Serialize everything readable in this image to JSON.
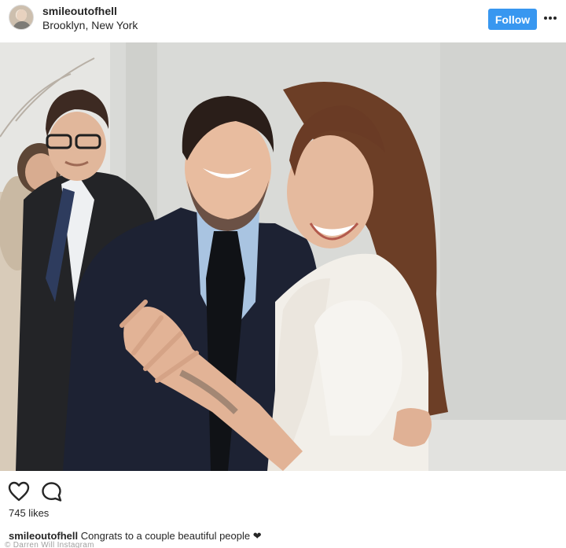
{
  "header": {
    "username": "smileoutofhell",
    "location": "Brooklyn, New York",
    "follow_label": "Follow"
  },
  "post": {
    "image_semantic": "wedding-photo",
    "likes_text": "745 likes",
    "caption_user": "smileoutofhell",
    "caption_text": " Congrats to a couple beautiful people ",
    "caption_emoji": "❤"
  },
  "watermark": "© Darren Will Instagram",
  "colors": {
    "follow_button": "#3897f0",
    "text": "#262626",
    "background": "#ffffff"
  },
  "icons": [
    "heart-icon",
    "comment-icon",
    "more-options-icon"
  ]
}
